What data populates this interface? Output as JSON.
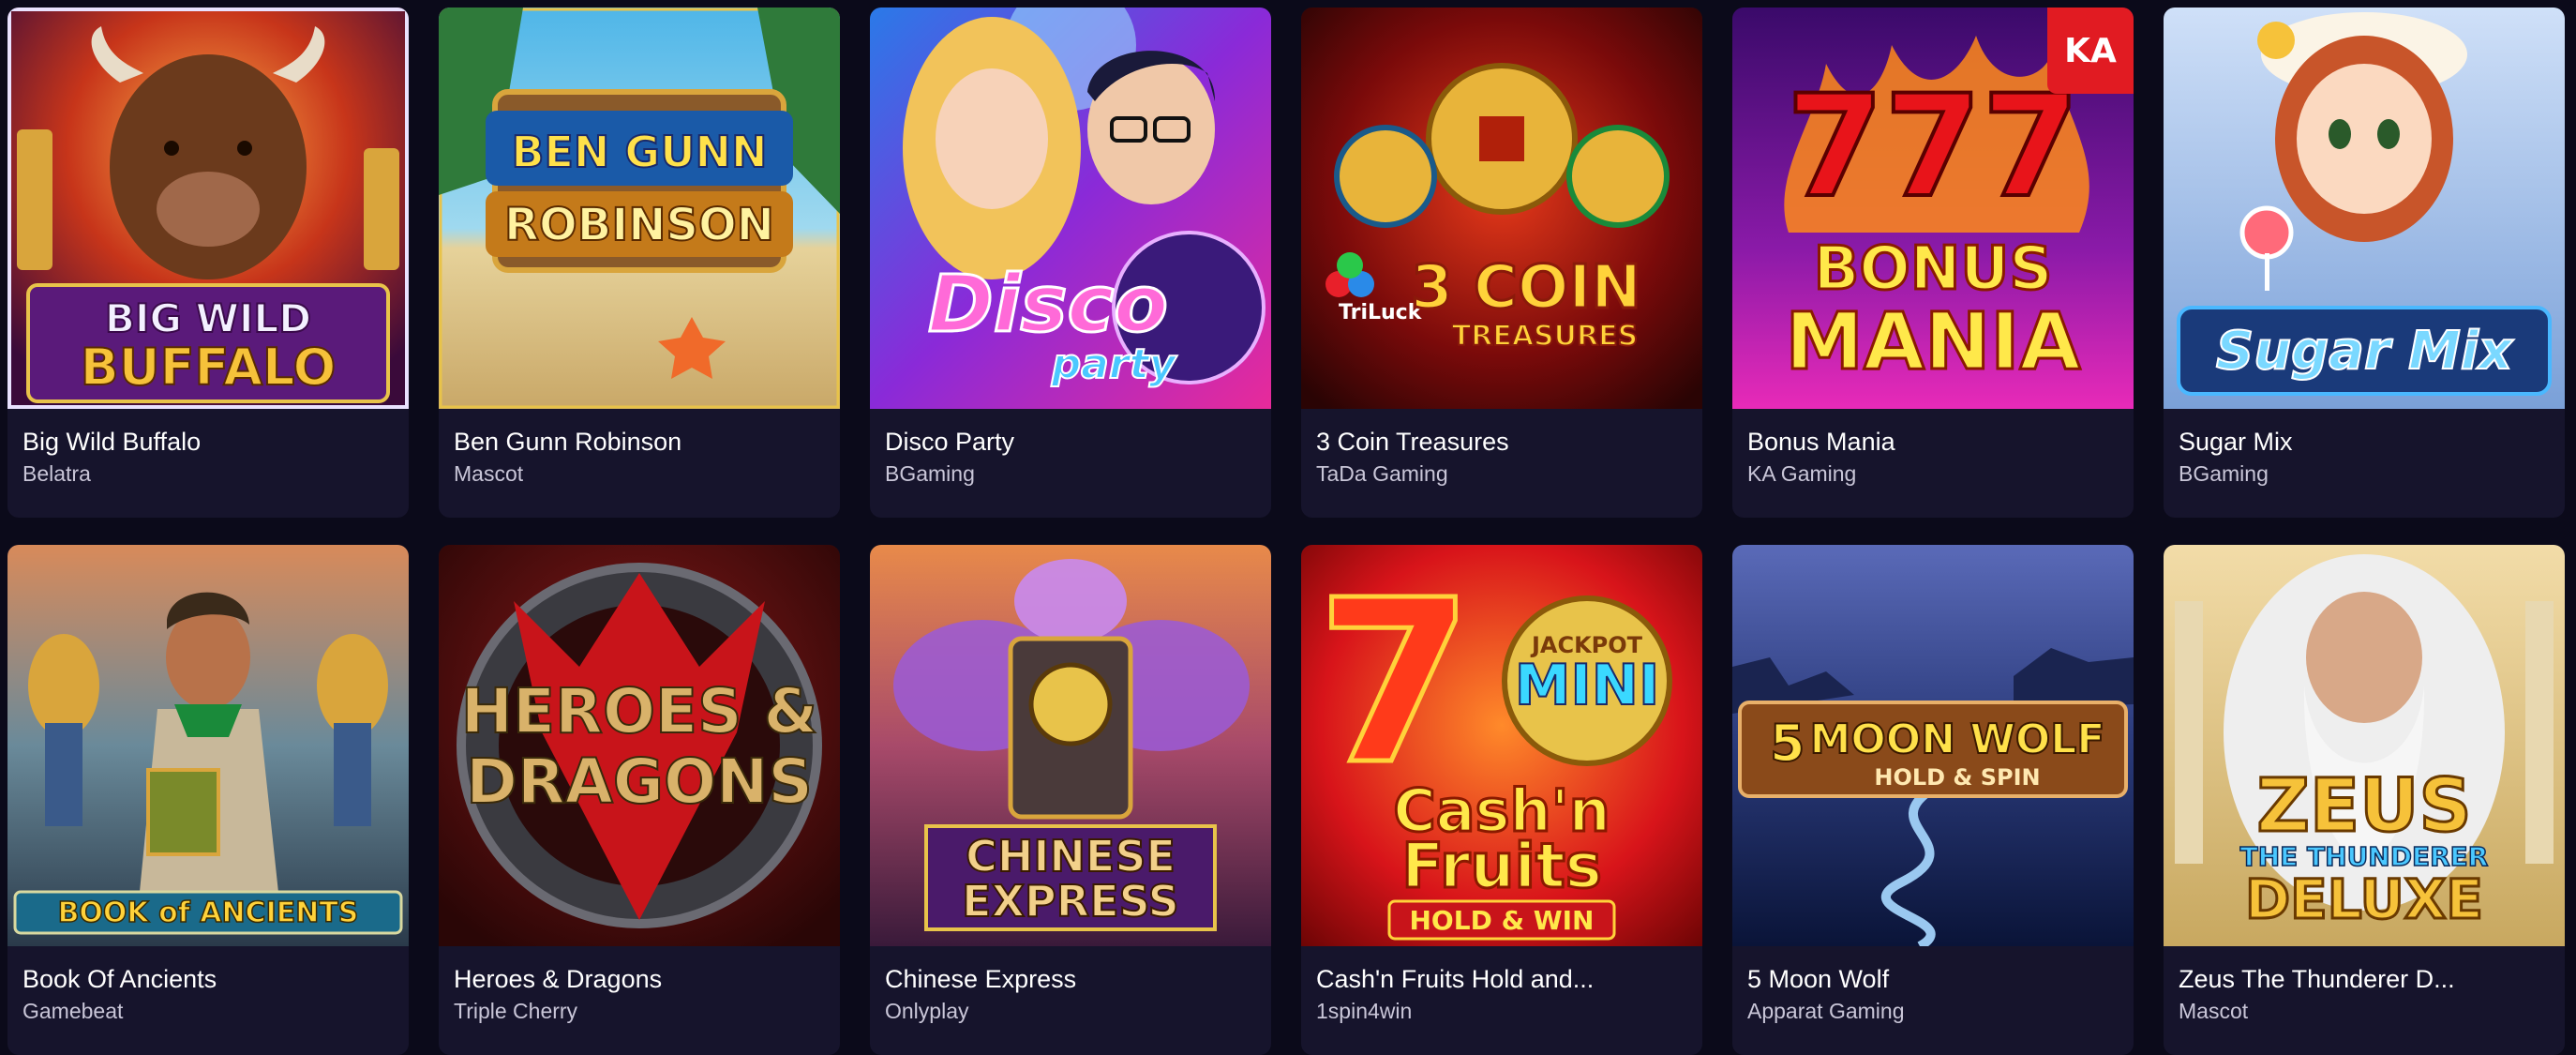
{
  "games": [
    {
      "title": "Big Wild Buffalo",
      "provider": "Belatra",
      "logo": [
        "BIG WILD",
        "BUFFALO"
      ],
      "icon": "buffalo-art"
    },
    {
      "title": "Ben Gunn Robinson",
      "provider": "Mascot",
      "logo": [
        "BEN GUNN",
        "ROBINSON"
      ],
      "icon": "treasure-chest-art"
    },
    {
      "title": "Disco Party",
      "provider": "BGaming",
      "logo": [
        "Disco",
        "party"
      ],
      "icon": "disco-couple-art"
    },
    {
      "title": "3 Coin Treasures",
      "provider": "TaDa Gaming",
      "logo": [
        "3 COIN",
        "TREASURES",
        "TriLuck"
      ],
      "icon": "coins-art"
    },
    {
      "title": "Bonus Mania",
      "provider": "KA Gaming",
      "logo": [
        "BONUS",
        "MANIA",
        "777"
      ],
      "badge": "KA",
      "icon": "sevens-art"
    },
    {
      "title": "Sugar Mix",
      "provider": "BGaming",
      "logo": [
        "Sugar Mix"
      ],
      "icon": "candy-girl-art"
    },
    {
      "title": "Book Of Ancients",
      "provider": "Gamebeat",
      "logo": [
        "BOOK of ANCIENTS"
      ],
      "icon": "explorer-art"
    },
    {
      "title": "Heroes & Dragons",
      "provider": "Triple Cherry",
      "logo": [
        "HEROES &",
        "DRAGONS"
      ],
      "icon": "dragon-art"
    },
    {
      "title": "Chinese Express",
      "provider": "Onlyplay",
      "logo": [
        "CHINESE",
        "EXPRESS"
      ],
      "icon": "train-art"
    },
    {
      "title": "Cash'n Fruits Hold and...",
      "provider": "1spin4win",
      "logo": [
        "Cash'n",
        "Fruits",
        "HOLD & WIN",
        "MINI",
        "JACKPOT"
      ],
      "icon": "seven-art"
    },
    {
      "title": "5 Moon Wolf",
      "provider": "Apparat Gaming",
      "logo": [
        "5",
        "MOON WOLF",
        "HOLD & SPIN"
      ],
      "icon": "canyon-art"
    },
    {
      "title": "Zeus The Thunderer D...",
      "provider": "Mascot",
      "logo": [
        "ZEUS",
        "THE THUNDERER",
        "DELUXE"
      ],
      "icon": "zeus-art"
    }
  ],
  "colors": {
    "background": "#0b0a1a",
    "card": "#16142c",
    "title": "#ffffff",
    "provider": "#c9c6d8",
    "badge": "#e11b22"
  }
}
